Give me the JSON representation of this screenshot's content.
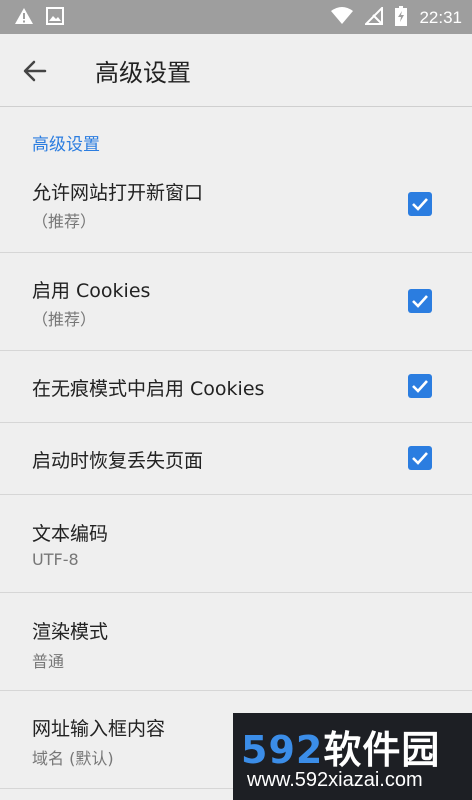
{
  "status_bar": {
    "time": "22:31"
  },
  "app_bar": {
    "title": "高级设置"
  },
  "section_header": "高级设置",
  "rows": [
    {
      "title": "允许网站打开新窗口",
      "subtitle": "（推荐）",
      "checked": true
    },
    {
      "title": "启用 Cookies",
      "subtitle": "（推荐）",
      "checked": true
    },
    {
      "title": "在无痕模式中启用 Cookies",
      "checked": true
    },
    {
      "title": "启动时恢复丢失页面",
      "checked": true
    },
    {
      "title": "文本编码",
      "subtitle": "UTF-8"
    },
    {
      "title": "渲染模式",
      "subtitle": "普通"
    },
    {
      "title": "网址输入框内容",
      "subtitle": "域名 (默认)"
    }
  ],
  "watermark": {
    "brand_number": "592",
    "brand_text": "软件园",
    "url": "www.592xiazai.com"
  },
  "colors": {
    "accent": "#2b7de0",
    "status_bar": "#9e9e9e",
    "background": "#efefef"
  }
}
